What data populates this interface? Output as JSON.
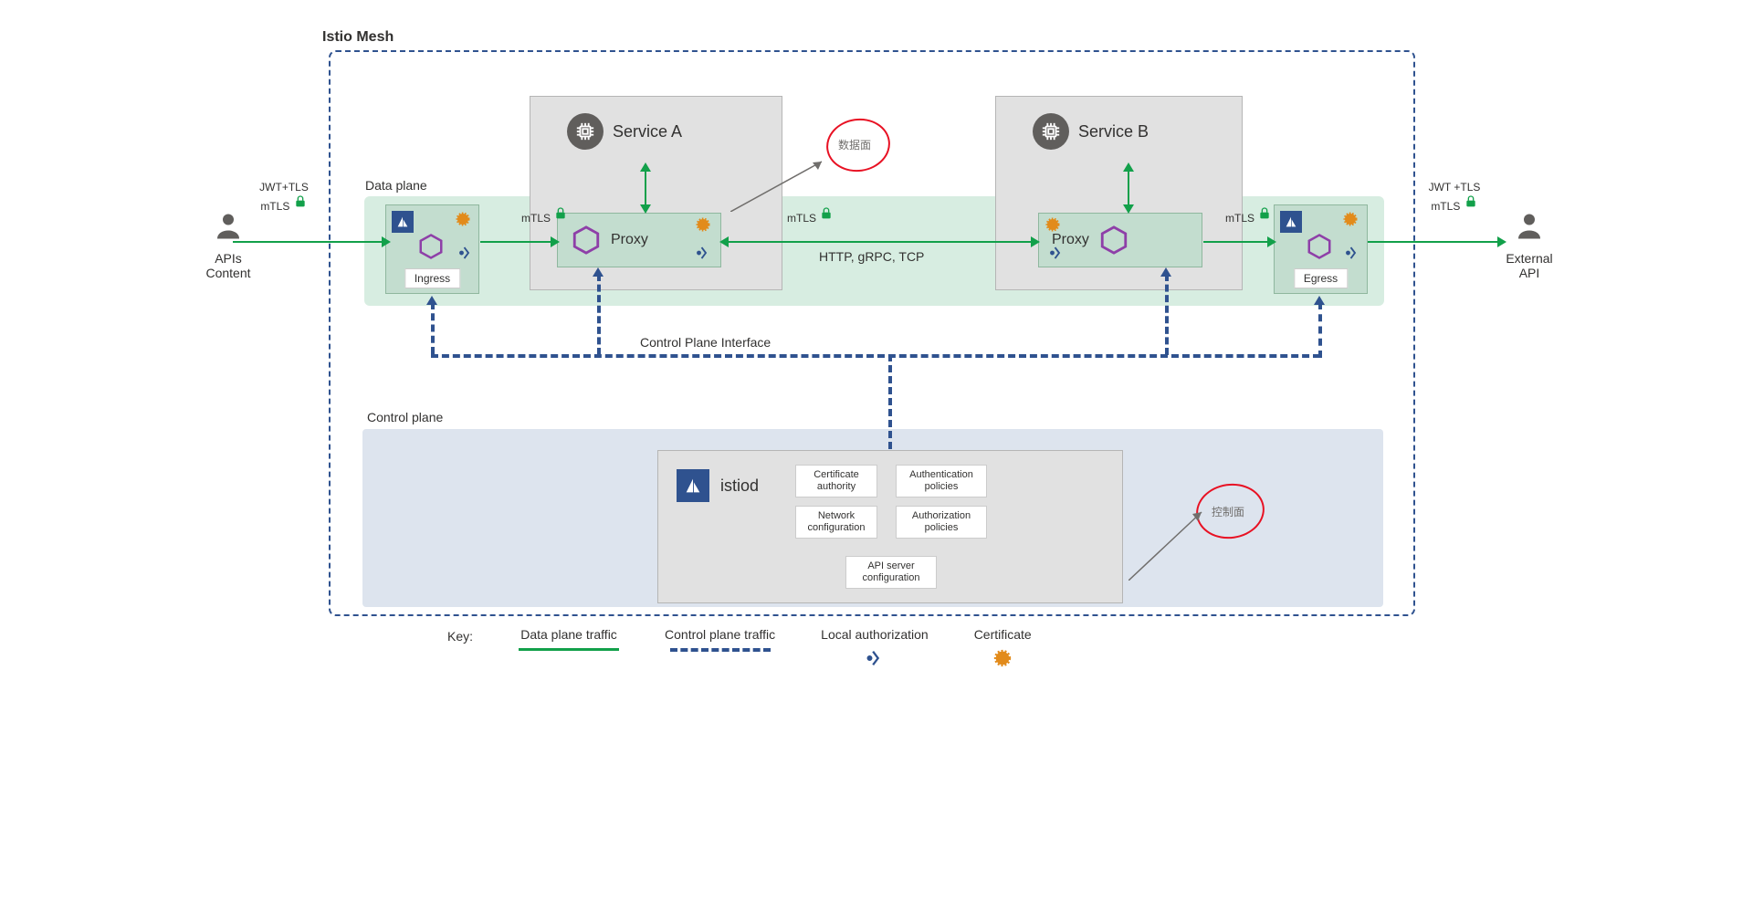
{
  "title": "Istio Mesh",
  "dataPlane": {
    "label": "Data plane",
    "ingress": "Ingress",
    "egress": "Egress",
    "proxy": "Proxy",
    "serviceA": "Service A",
    "serviceB": "Service B",
    "protocols": "HTTP, gRPC, TCP",
    "mtls": "mTLS"
  },
  "controlPlane": {
    "label": "Control plane",
    "istiod": "istiod",
    "interface": "Control Plane Interface",
    "policies": {
      "cert": "Certificate authority",
      "authn": "Authentication policies",
      "net": "Network configuration",
      "authz": "Authorization policies",
      "api": "API server configuration"
    }
  },
  "external": {
    "leftLabel": "APIs Content",
    "rightLabel": "External API",
    "jwtLeft": "JWT+TLS mTLS",
    "jwtRight": "JWT +TLS mTLS"
  },
  "annotations": {
    "dataPlane": "数据面",
    "controlPlane": "控制面"
  },
  "legend": {
    "key": "Key:",
    "dp": "Data plane traffic",
    "cp": "Control plane traffic",
    "auth": "Local authorization",
    "cert": "Certificate"
  }
}
